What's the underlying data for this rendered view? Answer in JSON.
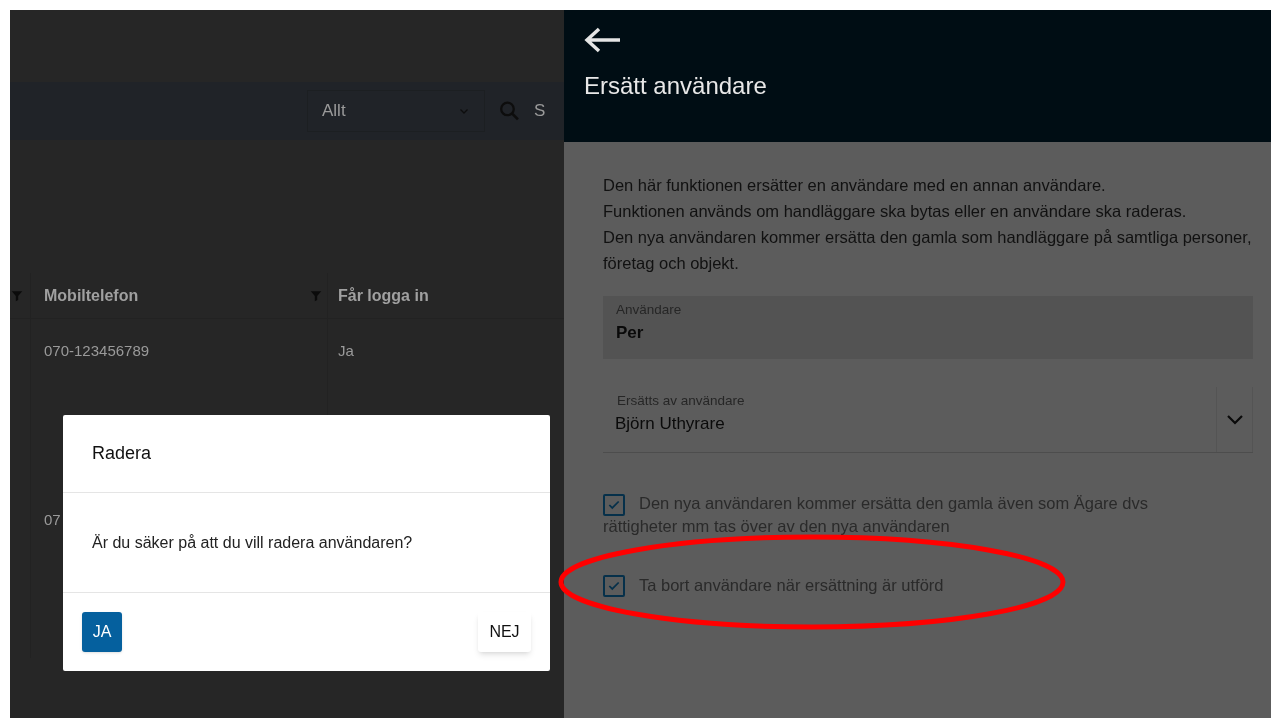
{
  "toolbar": {
    "filter": {
      "value": "Allt"
    },
    "search": {
      "placeholder": "S"
    }
  },
  "table": {
    "columns": [
      {
        "label": "Mobiltelefon"
      },
      {
        "label": "Får logga in"
      }
    ],
    "rows": [
      {
        "cells": [
          "070-123456789",
          "Ja"
        ]
      },
      {
        "cells": [
          "07",
          ""
        ]
      }
    ]
  },
  "dialog": {
    "title": "Radera",
    "message": "Är du säker på att du vill radera användaren?",
    "confirm": "JA",
    "cancel": "NEJ"
  },
  "panel": {
    "title": "Ersätt användare",
    "description": [
      "Den här funktionen ersätter en användare med en annan användare.",
      "Funktionen används om handläggare ska bytas eller en användare ska raderas.",
      "Den nya användaren kommer ersätta den gamla som handläggare på samtliga personer, företag och objekt."
    ],
    "user_field": {
      "label": "Användare",
      "value": "Per"
    },
    "replace_field": {
      "label": "Ersätts av användare",
      "value": "Björn Uthyrare"
    },
    "options": [
      {
        "label": "Den nya användaren kommer ersätta den gamla även som Ägare dvs rättigheter mm tas över av den nya användaren",
        "checked": true
      },
      {
        "label": "Ta bort användare när ersättning är utförd",
        "checked": true,
        "highlighted": true
      }
    ]
  }
}
